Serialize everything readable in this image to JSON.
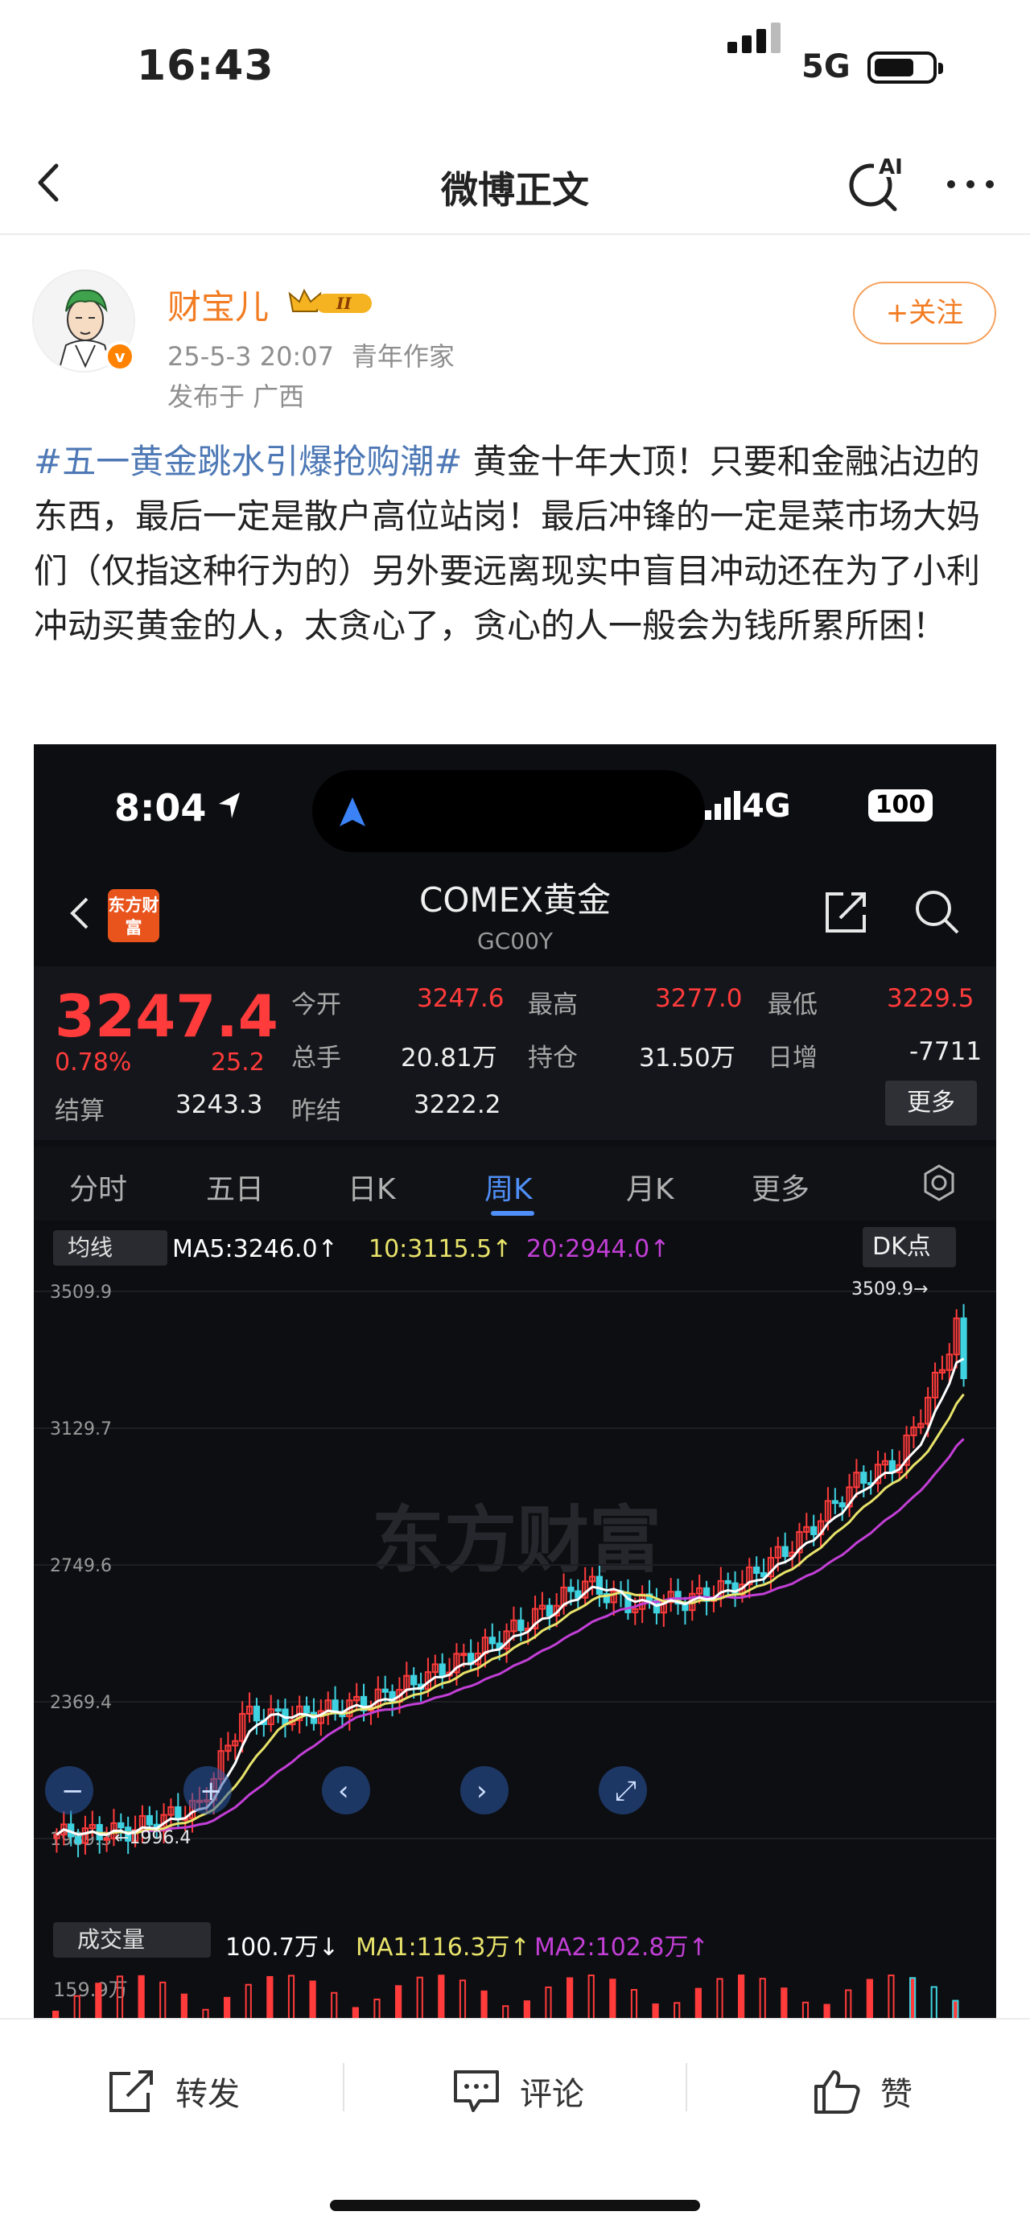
{
  "status_bar": {
    "time": "16:43",
    "network": "5G"
  },
  "nav": {
    "title": "微博正文",
    "ai_label": "AI"
  },
  "post": {
    "author": "财宝儿",
    "vip_level": "II",
    "verified_badge": "v",
    "date": "25-5-3 20:07",
    "author_title": "青年作家",
    "location": "发布于 广西",
    "follow_label": "+关注",
    "hashtag": "#五一黄金跳水引爆抢购潮#",
    "body": " 黄金十年大顶！只要和金融沾边的东西，最后一定是散户高位站岗！最后冲锋的一定是菜市场大妈们（仅指这种行为的）另外要远离现实中盲目冲动还在为了小利冲动买黄金的人，太贪心了，贪心的人一般会为钱所累所困！"
  },
  "screenshot": {
    "time": "8:04",
    "network": "4G",
    "battery": "100",
    "app_logo": "东方财富",
    "title": "COMEX黄金",
    "code": "GC00Y",
    "price": "3247.4",
    "change_pct": "0.78%",
    "change": "25.2",
    "quote": {
      "open_label": "今开",
      "open": "3247.6",
      "high_label": "最高",
      "high": "3277.0",
      "low_label": "最低",
      "low": "3229.5",
      "volume_label": "总手",
      "volume": "20.81万",
      "oi_label": "持仓",
      "oi": "31.50万",
      "daily_inc_label": "日增",
      "daily_inc": "-7711",
      "settle_label": "结算",
      "settle": "3243.3",
      "prev_settle_label": "昨结",
      "prev_settle": "3222.2",
      "more_label": "更多"
    },
    "tabs": [
      "分时",
      "五日",
      "日K",
      "周K",
      "月K",
      "更多"
    ],
    "active_tab": "周K",
    "ma_selector": "均线",
    "ma5": "MA5:3246.0↑",
    "ma10": "10:3115.5↑",
    "ma20": "20:2944.0↑",
    "dk_label": "DK点",
    "watermark": "东方财富",
    "vol_selector": "成交量",
    "vol_value": "100.7万↓",
    "vol_ma1": "MA1:116.3万↑",
    "vol_ma2": "MA2:102.8万↑",
    "vol_y_max": "159.9万",
    "colors": {
      "up": "#ff3b3b",
      "down": "#3fd2e0",
      "ma5": "#ffffff",
      "ma10": "#e8e36a",
      "ma20": "#c23fd6"
    }
  },
  "chart_data": {
    "type": "candlestick",
    "title": "COMEX黄金 周K",
    "y_ticks": [
      "3509.9",
      "3129.7",
      "2749.6",
      "2369.4",
      "1989.3"
    ],
    "ylim": [
      1989.3,
      3509.9
    ],
    "annotations": {
      "max_label": "3509.9→",
      "min_label": "←1996.4",
      "max": 3509.9,
      "min": 1996.4
    },
    "series": [
      {
        "name": "MA5",
        "last": 3246.0
      },
      {
        "name": "MA10",
        "last": 3115.5
      },
      {
        "name": "MA20",
        "last": 2944.0
      }
    ]
  },
  "actions": {
    "repost": "转发",
    "comment": "评论",
    "like": "赞"
  }
}
